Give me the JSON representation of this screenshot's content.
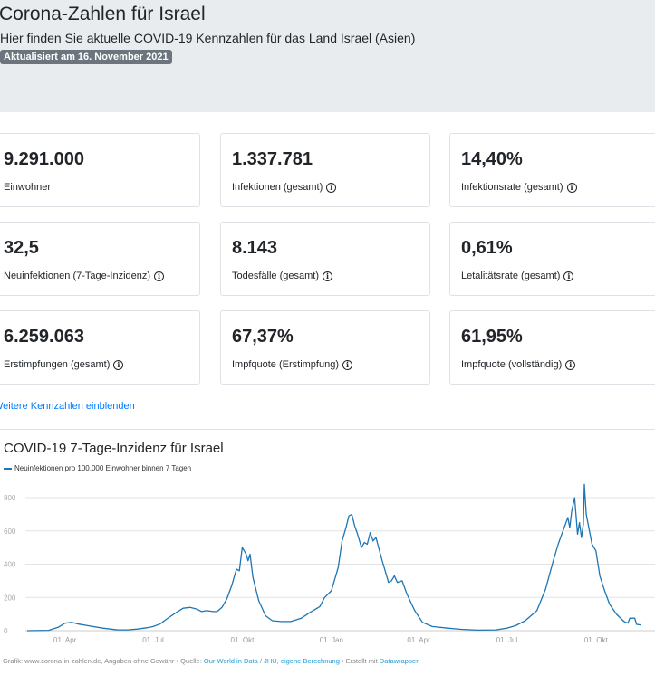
{
  "header": {
    "title": "Corona-Zahlen für Israel",
    "subtitle": "Hier finden Sie aktuelle COVID-19 Kennzahlen für das Land Israel (Asien)",
    "badge": "Aktualisiert am 16. November 2021"
  },
  "cards": [
    {
      "value": "9.291.000",
      "label": "Einwohner",
      "info": false
    },
    {
      "value": "1.337.781",
      "label": "Infektionen (gesamt)",
      "info": true
    },
    {
      "value": "14,40%",
      "label": "Infektionsrate (gesamt)",
      "info": true
    },
    {
      "value": "32,5",
      "label": "Neuinfektionen (7-Tage-Inzidenz)",
      "info": true
    },
    {
      "value": "8.143",
      "label": "Todesfälle (gesamt)",
      "info": true
    },
    {
      "value": "0,61%",
      "label": "Letalitätsrate (gesamt)",
      "info": true
    },
    {
      "value": "6.259.063",
      "label": "Erstimpfungen (gesamt)",
      "info": true
    },
    {
      "value": "67,37%",
      "label": "Impfquote (Erstimpfung)",
      "info": true
    },
    {
      "value": "61,95%",
      "label": "Impfquote (vollständig)",
      "info": true
    }
  ],
  "more_link": "Weitere Kennzahlen einblenden",
  "chart_data": {
    "type": "line",
    "title": "COVID-19 7-Tage-Inzidenz für Israel",
    "series": [
      {
        "name": "Neuinfektionen pro 100.000 Einwohner binnen 7 Tagen",
        "color": "#1d75b3",
        "points": [
          [
            "2020-02-22",
            0
          ],
          [
            "2020-03-15",
            2
          ],
          [
            "2020-03-25",
            20
          ],
          [
            "2020-04-01",
            45
          ],
          [
            "2020-04-08",
            50
          ],
          [
            "2020-04-15",
            40
          ],
          [
            "2020-04-25",
            30
          ],
          [
            "2020-05-10",
            15
          ],
          [
            "2020-05-25",
            5
          ],
          [
            "2020-06-05",
            5
          ],
          [
            "2020-06-15",
            10
          ],
          [
            "2020-06-25",
            18
          ],
          [
            "2020-07-01",
            25
          ],
          [
            "2020-07-08",
            40
          ],
          [
            "2020-07-15",
            70
          ],
          [
            "2020-07-25",
            110
          ],
          [
            "2020-08-01",
            135
          ],
          [
            "2020-08-08",
            140
          ],
          [
            "2020-08-15",
            130
          ],
          [
            "2020-08-20",
            115
          ],
          [
            "2020-08-25",
            120
          ],
          [
            "2020-09-01",
            115
          ],
          [
            "2020-09-05",
            115
          ],
          [
            "2020-09-10",
            140
          ],
          [
            "2020-09-15",
            190
          ],
          [
            "2020-09-20",
            270
          ],
          [
            "2020-09-25",
            370
          ],
          [
            "2020-09-28",
            360
          ],
          [
            "2020-10-01",
            500
          ],
          [
            "2020-10-03",
            480
          ],
          [
            "2020-10-05",
            460
          ],
          [
            "2020-10-07",
            420
          ],
          [
            "2020-10-09",
            460
          ],
          [
            "2020-10-12",
            320
          ],
          [
            "2020-10-18",
            180
          ],
          [
            "2020-10-25",
            90
          ],
          [
            "2020-11-01",
            60
          ],
          [
            "2020-11-10",
            55
          ],
          [
            "2020-11-20",
            55
          ],
          [
            "2020-12-01",
            75
          ],
          [
            "2020-12-10",
            110
          ],
          [
            "2020-12-20",
            145
          ],
          [
            "2020-12-25",
            200
          ],
          [
            "2021-01-01",
            240
          ],
          [
            "2021-01-08",
            380
          ],
          [
            "2021-01-12",
            540
          ],
          [
            "2021-01-16",
            620
          ],
          [
            "2021-01-19",
            690
          ],
          [
            "2021-01-22",
            700
          ],
          [
            "2021-01-25",
            630
          ],
          [
            "2021-01-28",
            580
          ],
          [
            "2021-02-01",
            500
          ],
          [
            "2021-02-04",
            530
          ],
          [
            "2021-02-07",
            520
          ],
          [
            "2021-02-10",
            590
          ],
          [
            "2021-02-13",
            540
          ],
          [
            "2021-02-16",
            560
          ],
          [
            "2021-02-22",
            430
          ],
          [
            "2021-03-01",
            290
          ],
          [
            "2021-03-04",
            300
          ],
          [
            "2021-03-07",
            330
          ],
          [
            "2021-03-10",
            290
          ],
          [
            "2021-03-15",
            300
          ],
          [
            "2021-03-20",
            220
          ],
          [
            "2021-03-28",
            120
          ],
          [
            "2021-04-05",
            50
          ],
          [
            "2021-04-15",
            25
          ],
          [
            "2021-05-01",
            15
          ],
          [
            "2021-05-15",
            8
          ],
          [
            "2021-06-01",
            3
          ],
          [
            "2021-06-20",
            5
          ],
          [
            "2021-07-01",
            15
          ],
          [
            "2021-07-10",
            30
          ],
          [
            "2021-07-20",
            60
          ],
          [
            "2021-08-01",
            120
          ],
          [
            "2021-08-10",
            250
          ],
          [
            "2021-08-18",
            420
          ],
          [
            "2021-08-23",
            520
          ],
          [
            "2021-08-28",
            600
          ],
          [
            "2021-09-02",
            680
          ],
          [
            "2021-09-04",
            620
          ],
          [
            "2021-09-06",
            720
          ],
          [
            "2021-09-09",
            800
          ],
          [
            "2021-09-12",
            580
          ],
          [
            "2021-09-14",
            650
          ],
          [
            "2021-09-16",
            560
          ],
          [
            "2021-09-18",
            640
          ],
          [
            "2021-09-19",
            880
          ],
          [
            "2021-09-21",
            700
          ],
          [
            "2021-09-23",
            640
          ],
          [
            "2021-09-27",
            520
          ],
          [
            "2021-10-01",
            480
          ],
          [
            "2021-10-05",
            330
          ],
          [
            "2021-10-10",
            240
          ],
          [
            "2021-10-15",
            160
          ],
          [
            "2021-10-22",
            100
          ],
          [
            "2021-10-30",
            55
          ],
          [
            "2021-11-03",
            45
          ],
          [
            "2021-11-05",
            75
          ],
          [
            "2021-11-10",
            75
          ],
          [
            "2021-11-12",
            38
          ],
          [
            "2021-11-16",
            35
          ]
        ]
      }
    ],
    "yticks": [
      0,
      200,
      400,
      600,
      800
    ],
    "ylim": [
      0,
      880
    ],
    "xticks": [
      [
        "2020-04-01",
        "01. Apr"
      ],
      [
        "2020-07-01",
        "01. Jul"
      ],
      [
        "2020-10-01",
        "01. Okt"
      ],
      [
        "2021-01-01",
        "01. Jan"
      ],
      [
        "2021-04-01",
        "01. Apr"
      ],
      [
        "2021-07-01",
        "01. Jul"
      ],
      [
        "2021-10-01",
        "01. Okt"
      ]
    ],
    "xlim": [
      "2020-02-22",
      "2021-11-16"
    ],
    "grid": true,
    "legend": "top-left"
  },
  "footer": {
    "prefix": "Grafik: www.corona-in-zahlen.de, Angaben ohne Gewähr • Quelle: ",
    "src1": "Our World in Data",
    "sep": " / ",
    "src2": "JHU, eigene Berechnung",
    "mid": " • Erstellt mit ",
    "tool": "Datawrapper"
  }
}
